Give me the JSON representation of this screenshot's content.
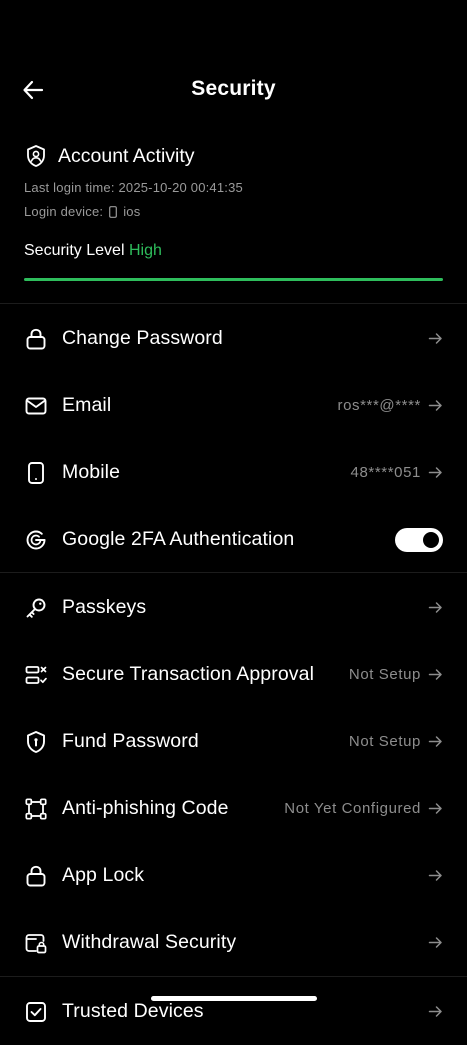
{
  "header": {
    "title": "Security"
  },
  "activity": {
    "title": "Account Activity",
    "last_login_label": "Last login time:",
    "last_login_value": "2025-10-20 00:41:35",
    "login_device_label": "Login device:",
    "login_device_value": "ios",
    "security_level_label": "Security Level",
    "security_level_value": "High",
    "security_level_color": "#2ebd5c",
    "security_level_fill": 1.0
  },
  "settings": {
    "change_password": {
      "label": "Change Password",
      "icon": "lock-icon"
    },
    "email": {
      "label": "Email",
      "value": "ros***@****",
      "icon": "mail-icon"
    },
    "mobile": {
      "label": "Mobile",
      "value": "48****051",
      "icon": "phone-icon"
    },
    "google_2fa": {
      "label": "Google 2FA Authentication",
      "enabled": true,
      "icon": "google-icon"
    },
    "passkeys": {
      "label": "Passkeys",
      "icon": "key-icon"
    },
    "secure_transaction": {
      "label": "Secure Transaction Approval",
      "value": "Not Setup",
      "icon": "approval-icon"
    },
    "fund_password": {
      "label": "Fund Password",
      "value": "Not Setup",
      "icon": "shield-icon"
    },
    "anti_phishing": {
      "label": "Anti-phishing Code",
      "value": "Not Yet Configured",
      "icon": "frame-icon"
    },
    "app_lock": {
      "label": "App Lock",
      "icon": "lock-icon"
    },
    "withdrawal_security": {
      "label": "Withdrawal Security",
      "icon": "wallet-lock-icon"
    },
    "trusted_devices": {
      "label": "Trusted Devices",
      "icon": "check-box-icon"
    }
  }
}
